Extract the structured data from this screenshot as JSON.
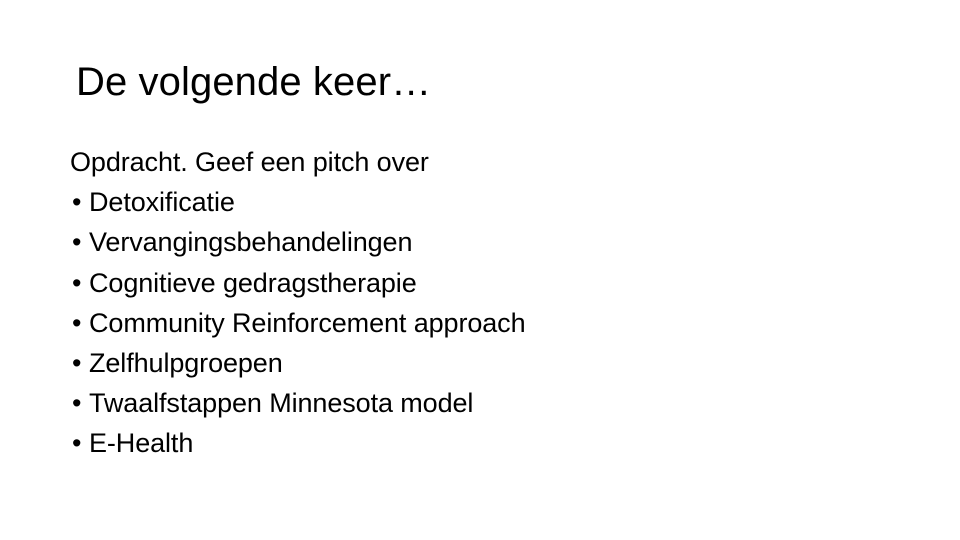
{
  "slide": {
    "title": "De volgende keer…",
    "lead_text": "Opdracht. Geef een pitch over",
    "bullet_marker": "•",
    "bullets": [
      "Detoxificatie",
      "Vervangingsbehandelingen",
      "Cognitieve gedragstherapie",
      "Community Reinforcement approach",
      "Zelfhulpgroepen",
      "Twaalfstappen Minnesota model",
      "E-Health"
    ],
    "colors": {
      "background": "#ffffff",
      "text": "#000000"
    }
  }
}
